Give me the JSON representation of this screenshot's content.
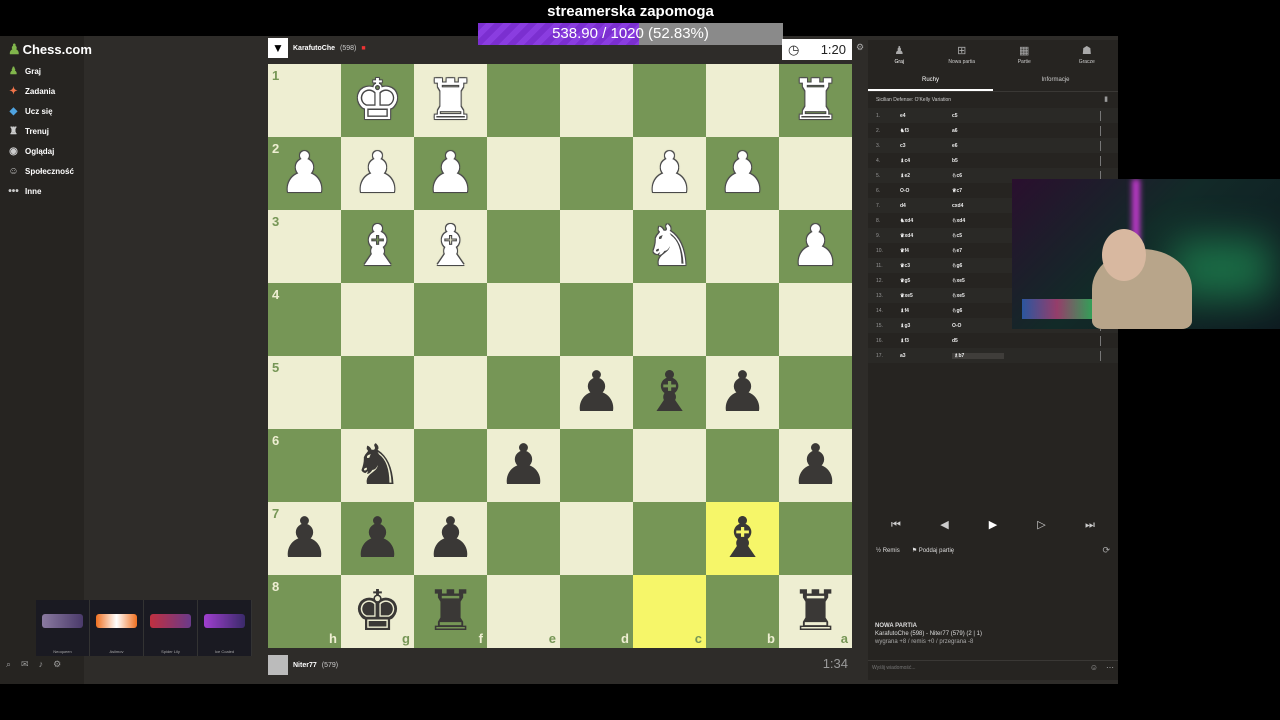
{
  "stream": {
    "donation_title": "streamerska zapomoga",
    "donation_text": "538.90 / 1020 (52.83%)",
    "donation_progress": 0.5283
  },
  "site": {
    "logo": "Chess.com",
    "nav": [
      "Graj",
      "Zadania",
      "Ucz się",
      "Trenuj",
      "Oglądaj",
      "Społeczność",
      "Inne"
    ]
  },
  "skins": [
    "Neoqueen",
    "Asiimov",
    "Spider Lily",
    "Ice Coaled"
  ],
  "top_player": {
    "name": "KarafutoChe",
    "rating": "(598)",
    "clock": "1:20"
  },
  "bottom_player": {
    "name": "Niter77",
    "rating": "(579)",
    "clock": "1:34"
  },
  "board": {
    "rows": [
      {
        "rank": "1",
        "cells": [
          "",
          "wK",
          "wR",
          "",
          "",
          "",
          "",
          "wR"
        ]
      },
      {
        "rank": "2",
        "cells": [
          "wP",
          "wP",
          "wP",
          "",
          "",
          "wP",
          "wP",
          ""
        ]
      },
      {
        "rank": "3",
        "cells": [
          "",
          "wB",
          "wB",
          "",
          "",
          "wN",
          "",
          "wP"
        ]
      },
      {
        "rank": "4",
        "cells": [
          "",
          "",
          "",
          "",
          "",
          "",
          "",
          ""
        ]
      },
      {
        "rank": "5",
        "cells": [
          "",
          "",
          "",
          "",
          "bP",
          "bB",
          "bP",
          ""
        ]
      },
      {
        "rank": "6",
        "cells": [
          "",
          "bN",
          "",
          "bP",
          "",
          "",
          "",
          "bP"
        ]
      },
      {
        "rank": "7",
        "cells": [
          "bP",
          "bP",
          "bP",
          "",
          "",
          "",
          "bB",
          ""
        ]
      },
      {
        "rank": "8",
        "cells": [
          "",
          "bK",
          "bR",
          "",
          "",
          "",
          "",
          "bR"
        ]
      }
    ],
    "files": [
      "h",
      "g",
      "f",
      "e",
      "d",
      "c",
      "b",
      "a"
    ],
    "highlights": [
      [
        6,
        6
      ],
      [
        7,
        5
      ]
    ]
  },
  "panel": {
    "tabs": [
      "Graj",
      "Nowa partia",
      "Partie",
      "Gracze"
    ],
    "sub_tabs": [
      "Ruchy",
      "Informacje"
    ],
    "opening": "Sicilian Defense: O'Kelly Variation",
    "moves": [
      [
        "1.",
        "e4",
        "c5"
      ],
      [
        "2.",
        "♞f3",
        "a6"
      ],
      [
        "3.",
        "c3",
        "e6"
      ],
      [
        "4.",
        "♝c4",
        "b5"
      ],
      [
        "5.",
        "♝e2",
        "♘c6"
      ],
      [
        "6.",
        "O-O",
        "♕c7"
      ],
      [
        "7.",
        "d4",
        "cxd4"
      ],
      [
        "8.",
        "♞xd4",
        "♘xd4"
      ],
      [
        "9.",
        "♛xd4",
        "♘c5"
      ],
      [
        "10.",
        "♛f4",
        "♘e7"
      ],
      [
        "11.",
        "♛c3",
        "♘g6"
      ],
      [
        "12.",
        "♛g5",
        "♘xe5"
      ],
      [
        "13.",
        "♛xe5",
        "♘xe5"
      ],
      [
        "14.",
        "♝f4",
        "♘g6"
      ],
      [
        "15.",
        "♝g3",
        "O-O"
      ],
      [
        "16.",
        "♝f3",
        "d5"
      ],
      [
        "17.",
        "a3",
        "♗b7"
      ]
    ],
    "controls": [
      "⏮",
      "◀",
      "▶",
      "▷",
      "⏭"
    ],
    "draw_label": "Remis",
    "resign_label": "Poddaj partię",
    "game_info_title": "NOWA PARTIA",
    "game_info_players": "KarafutoChe (598) - Niter77 (579) (2 | 1)",
    "game_info_stakes": "wygrana +8 / remis +0 / przegrana -8",
    "chat_placeholder": "Wyślij wiadomość..."
  }
}
